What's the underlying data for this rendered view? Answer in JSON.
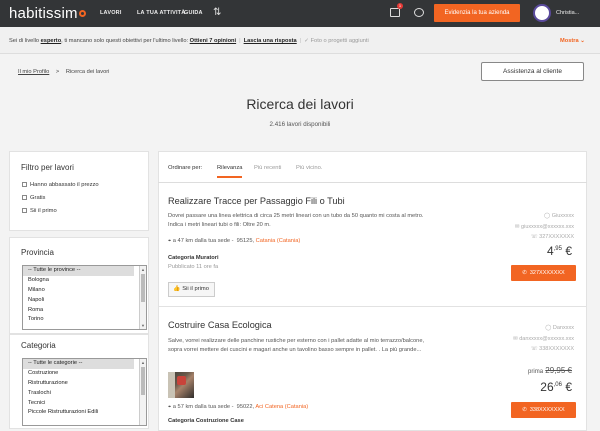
{
  "topbar": {
    "logo": "habitissim",
    "nav": [
      "LAVORI",
      "LA TUA ATTIVITÀ",
      "GUIDA"
    ],
    "notification_count": "1",
    "highlight_button": "Evidenzia la tua azienda",
    "username": "Christia..."
  },
  "progress": {
    "text_a": "Sei di livello ",
    "level": "esperto",
    "text_b": ", ti mancano solo questi obiettivi per l'ultimo livello:",
    "goal1": "Ottieni 7 opinioni",
    "goal2": "Lascia una risposta",
    "goal3": "Foto o progetti aggiunti",
    "more": "Mostra"
  },
  "breadcrumb": {
    "link": "Il mio Profilo",
    "sep": ">",
    "current": "Ricerca dei lavori"
  },
  "assist_button": "Assistenza al cliente",
  "page": {
    "title": "Ricerca dei lavori",
    "count": "2.416 lavori disponibili"
  },
  "filters": {
    "title": "Filtro per lavori",
    "options": [
      "Hanno abbassato il prezzo",
      "Gratis",
      "Sii il primo"
    ]
  },
  "provincia": {
    "title": "Provincia",
    "options": [
      "-- Tutte le province --",
      "Bologna",
      "Milano",
      "Napoli",
      "Roma",
      "Torino"
    ]
  },
  "categoria": {
    "title": "Categoria",
    "options": [
      "-- Tutte le categorie --",
      "Costruzione",
      "Ristrutturazione",
      "Traslochi",
      "Tecnici",
      "Piccole Ristrutturazioni Edili"
    ]
  },
  "sort": {
    "label": "Ordinare per:",
    "tabs": [
      "Rilevanza",
      "Più recenti",
      "Più vicino."
    ]
  },
  "jobs": [
    {
      "title": "Realizzare Tracce per Passaggio Fili o Tubi",
      "desc": "Dovrei passare una linea elettrica di circa 25 metri lineari con un tubo da 50 quanto mi costa al metro. Indica i metri lineari tubi o fili: Oltre 20 m.",
      "distance": "a 47 km dalla tua sede",
      "zip": "95125,",
      "city": "Catania",
      "prov": "(Catania)",
      "category": "Categoria Muratori",
      "published": "Pubblicato 11 ore fa",
      "first_btn": "Sii il primo",
      "contact_name": "Giuxxxxx",
      "contact_email": "giuxxxxx@xxxxxx.xxx",
      "contact_phone": "327XXXXXXX",
      "price_int": "4",
      "price_dec": ",95",
      "price_cur": "€",
      "phone_btn": "327XXXXXXX"
    },
    {
      "title": "Costruire Casa Ecologica",
      "desc": "Salve, vorrei realizzare delle panchine rustiche per esterno con i pallet adatte al mio terrazzo/balcone, sopra vorrei mettere dei cuscini e magari anche un tavolino basso sempre in pallet. . La più grande...",
      "distance": "a 57 km dalla tua sede",
      "zip": "95022,",
      "city": "Aci Catena",
      "prov": "(Catania)",
      "category": "Categoria Costruzione Case",
      "contact_name": "Danxxxx",
      "contact_email": "danxxxxx@xxxxxx.xxx",
      "contact_phone": "338XXXXXXX",
      "old_label": "prima",
      "old_price": "29,95 €",
      "price_int": "26",
      "price_dec": ",06",
      "price_cur": "€",
      "phone_btn": "338XXXXXXX"
    }
  ],
  "colors": {
    "accent": "#f26522",
    "topbar": "#333537"
  },
  "icons": [
    "sort-arrows-icon",
    "gift-icon",
    "chat-icon",
    "location-icon",
    "user-icon",
    "mail-icon",
    "phone-icon",
    "thumb-up-icon",
    "check-circle-icon"
  ]
}
